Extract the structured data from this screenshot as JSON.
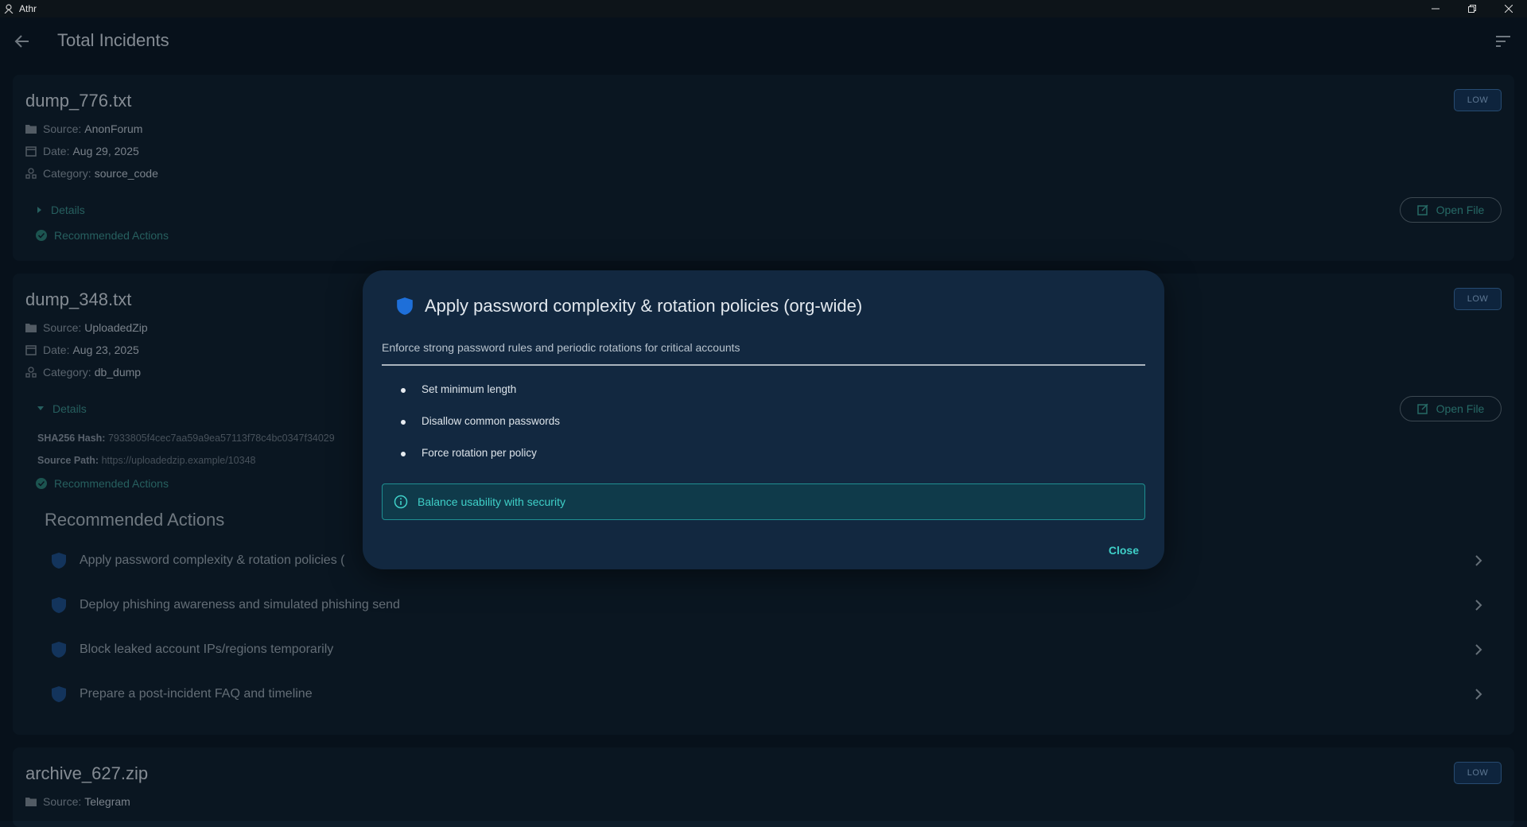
{
  "window": {
    "app_title": "Athr"
  },
  "header": {
    "title": "Total Incidents"
  },
  "incidents": [
    {
      "filename": "dump_776.txt",
      "severity": "LOW",
      "source_label": "Source:",
      "source": "AnonForum",
      "date_label": "Date:",
      "date": "Aug 29, 2025",
      "category_label": "Category:",
      "category": "source_code",
      "details_label": "Details",
      "recommended_label": "Recommended Actions",
      "open_file_label": "Open File"
    },
    {
      "filename": "dump_348.txt",
      "severity": "LOW",
      "source_label": "Source:",
      "source": "UploadedZip",
      "date_label": "Date:",
      "date": "Aug 23, 2025",
      "category_label": "Category:",
      "category": "db_dump",
      "details_label": "Details",
      "hash_label": "SHA256 Hash:",
      "hash": "7933805f4cec7aa59a9ea57113f78c4bc0347f34029",
      "path_label": "Source Path:",
      "path": "https://uploadedzip.example/10348",
      "recommended_label": "Recommended Actions",
      "open_file_label": "Open File",
      "rec_heading": "Recommended Actions",
      "actions": [
        "Apply password complexity & rotation policies (",
        "Deploy phishing awareness and simulated phishing send",
        "Block leaked account IPs/regions temporarily",
        "Prepare a post-incident FAQ and timeline"
      ]
    },
    {
      "filename": "archive_627.zip",
      "severity": "LOW",
      "source_label": "Source:",
      "source": "Telegram"
    }
  ],
  "dialog": {
    "title": "Apply password complexity & rotation policies (org-wide)",
    "subtitle": "Enforce strong password rules and periodic rotations for critical accounts",
    "steps": [
      "Set minimum length",
      "Disallow common passwords",
      "Force rotation per policy"
    ],
    "note": "Balance usability with security",
    "close_label": "Close"
  },
  "colors": {
    "accent": "#3fd0c8",
    "badge": "#143456",
    "shield": "#1e6fd9"
  }
}
